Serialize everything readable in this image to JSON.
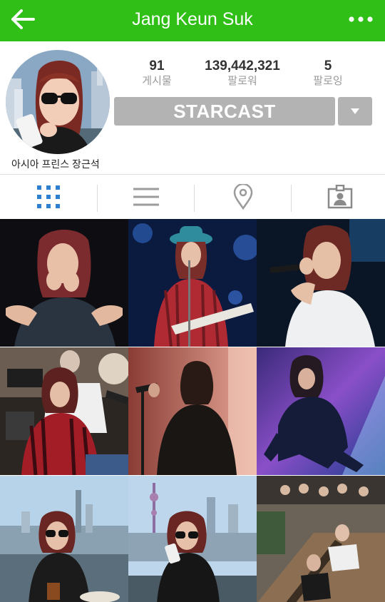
{
  "header": {
    "title": "Jang Keun Suk",
    "back_icon": "arrow-left-icon",
    "menu_icon": "more-dots-icon",
    "brand_color": "#2fbf17"
  },
  "profile": {
    "avatar_caption": "아시아 프린스 장근석",
    "stats": {
      "posts": {
        "value": "91",
        "label": "게시물"
      },
      "followers": {
        "value": "139,442,321",
        "label": "팔로워"
      },
      "following": {
        "value": "5",
        "label": "팔로잉"
      }
    },
    "cta_label": "STARCAST",
    "dropdown_icon": "caret-down-icon"
  },
  "tabs": [
    {
      "icon": "grid-icon",
      "active": true
    },
    {
      "icon": "list-icon",
      "active": false
    },
    {
      "icon": "location-pin-icon",
      "active": false
    },
    {
      "icon": "tagged-person-icon",
      "active": false
    }
  ],
  "photos": [
    {
      "scene": "concert-blowing-kiss"
    },
    {
      "scene": "concert-cowboy-hat-guitar"
    },
    {
      "scene": "concert-microphone-white-tee"
    },
    {
      "scene": "stage-band-red-plaid"
    },
    {
      "scene": "stage-silhouette-mic"
    },
    {
      "scene": "stage-spotlight-crouch"
    },
    {
      "scene": "city-skyline-sunglasses"
    },
    {
      "scene": "city-skyline-phone"
    },
    {
      "scene": "balcony-group-photo"
    }
  ]
}
